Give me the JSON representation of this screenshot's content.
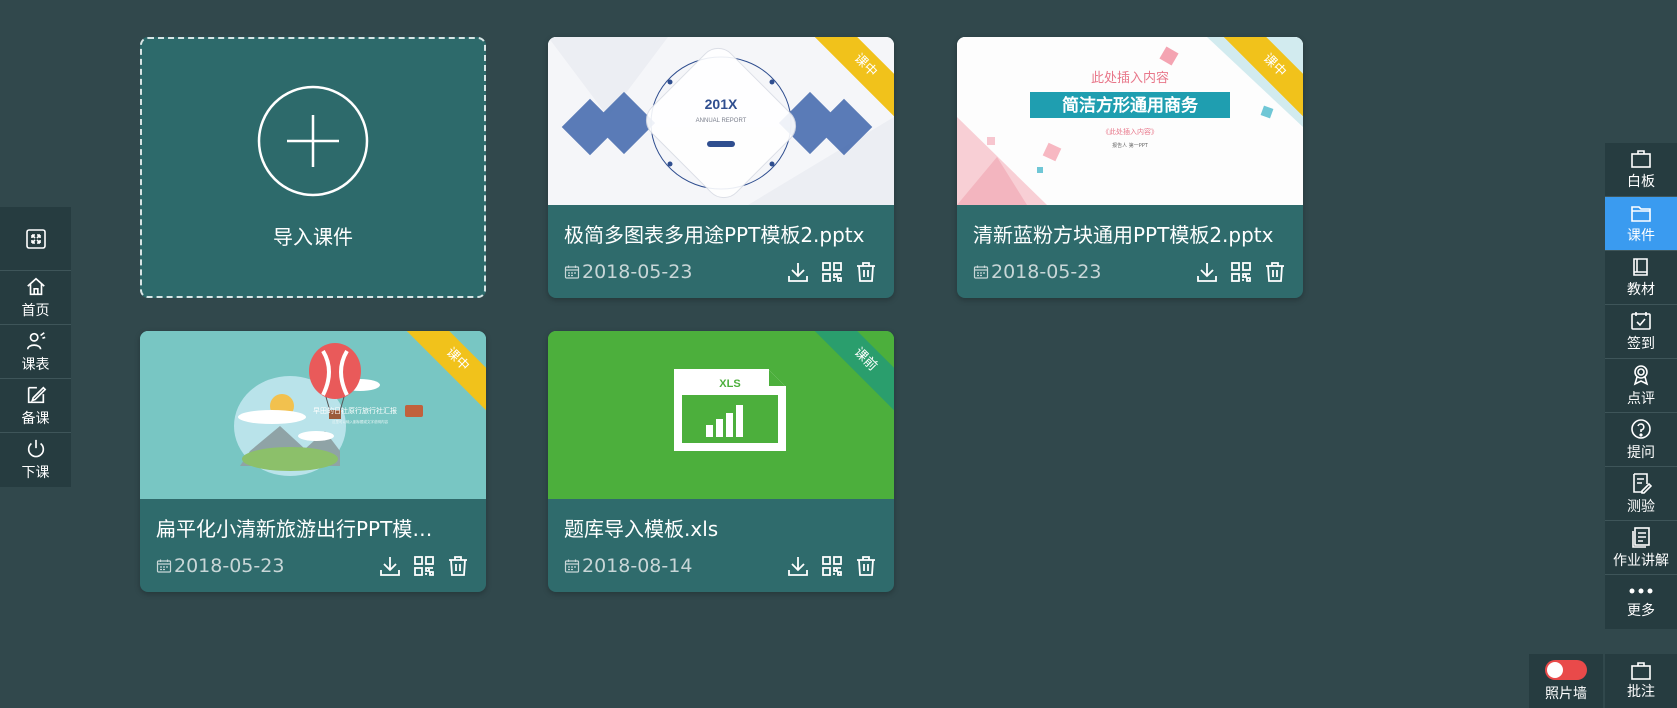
{
  "left_toolbar": {
    "expand_icon": "fullscreen-icon",
    "items": [
      {
        "label": "首页",
        "icon": "home-icon"
      },
      {
        "label": "课表",
        "icon": "user-schedule-icon"
      },
      {
        "label": "备课",
        "icon": "edit-icon"
      },
      {
        "label": "下课",
        "icon": "power-icon"
      }
    ]
  },
  "right_toolbar": {
    "items": [
      {
        "label": "白板",
        "icon": "whiteboard-icon"
      },
      {
        "label": "课件",
        "icon": "folder-icon",
        "active": true
      },
      {
        "label": "教材",
        "icon": "book-icon"
      },
      {
        "label": "签到",
        "icon": "checkin-icon"
      },
      {
        "label": "点评",
        "icon": "award-icon"
      },
      {
        "label": "提问",
        "icon": "question-icon"
      },
      {
        "label": "测验",
        "icon": "quiz-icon"
      },
      {
        "label": "作业讲解",
        "icon": "homework-icon"
      },
      {
        "label": "更多",
        "icon": "more-icon"
      }
    ]
  },
  "bottom_right": {
    "photo_wall_label": "照片墙",
    "annotate_label": "批注"
  },
  "import_card": {
    "label": "导入课件"
  },
  "cards": [
    {
      "name": "极简多图表多用途PPT模板2.pptx",
      "date": "2018-05-23",
      "ribbon": "课中",
      "thumb": {
        "title": "201X",
        "subtitle": "ANNUAL REPORT"
      }
    },
    {
      "name": "清新蓝粉方块通用PPT模板2.pptx",
      "date": "2018-05-23",
      "ribbon": "课中",
      "thumb": {
        "top": "此处插入内容",
        "title": "简洁方形通用商务",
        "sub": "《此处插入内容》",
        "tiny": "报告人  第一PPT"
      }
    },
    {
      "name": "扁平化小清新旅游出行PPT模…",
      "date": "2018-05-23",
      "ribbon": "课中",
      "thumb": {
        "title": "早田的日社原行旅行社汇报",
        "sub": "这里可以输入副标题或文字说明内容"
      }
    },
    {
      "name": "题库导入模板.xls",
      "date": "2018-08-14",
      "ribbon": "课前",
      "thumb": {
        "title": "XLS"
      }
    }
  ],
  "colors": {
    "background": "#31484c",
    "card": "#2f6b6c",
    "active": "#3a9bf0",
    "ribbon_yellow": "#f1c21b",
    "ribbon_green": "#2a9e6d",
    "xls_green": "#4caf3c"
  }
}
